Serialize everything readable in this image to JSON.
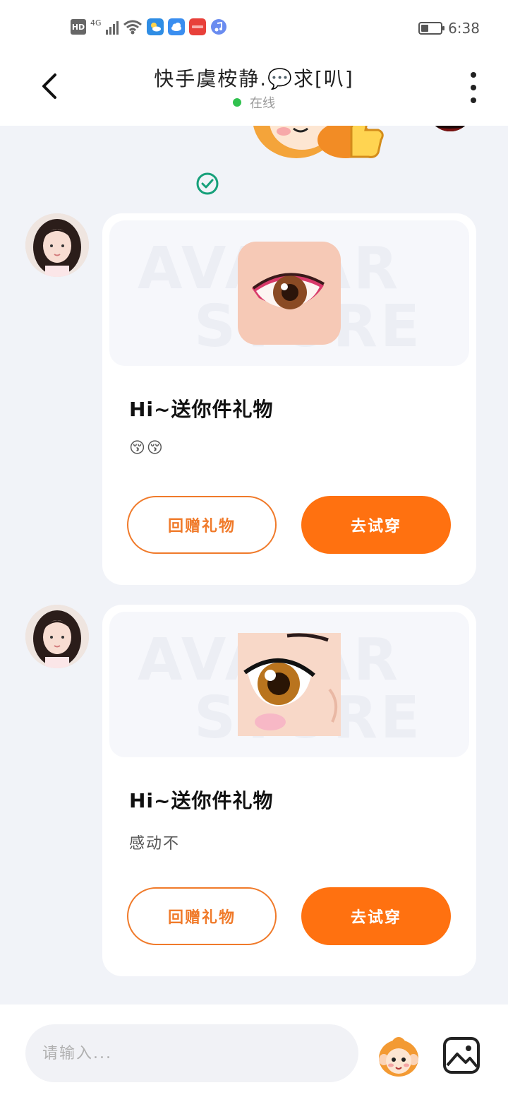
{
  "status_bar": {
    "hd_label": "HD",
    "network_label": "4G",
    "time": "6:38",
    "battery_level": 0.4,
    "icons": [
      "signal-icon",
      "wifi-icon",
      "weather-app-icon",
      "cloud-app-icon",
      "huawei-app-icon",
      "music-app-icon",
      "battery-icon"
    ]
  },
  "header": {
    "title": "快手虞桉静.💬求[叭]",
    "status_text": "在线",
    "status_color": "#31c14f"
  },
  "messages": [
    {
      "title": "Hi~送你件礼物",
      "text": "😚😚",
      "return_gift_label": "回赠礼物",
      "try_on_label": "去试穿"
    },
    {
      "title": "Hi~送你件礼物",
      "text": "感动不",
      "return_gift_label": "回赠礼物",
      "try_on_label": "去试穿"
    }
  ],
  "watermark": {
    "line1": "AVATAR",
    "line2": "STORE"
  },
  "input": {
    "placeholder": "请输入..."
  },
  "colors": {
    "accent": "#ff7110",
    "accent_outline": "#f07a2a",
    "background": "#f1f3f8"
  }
}
